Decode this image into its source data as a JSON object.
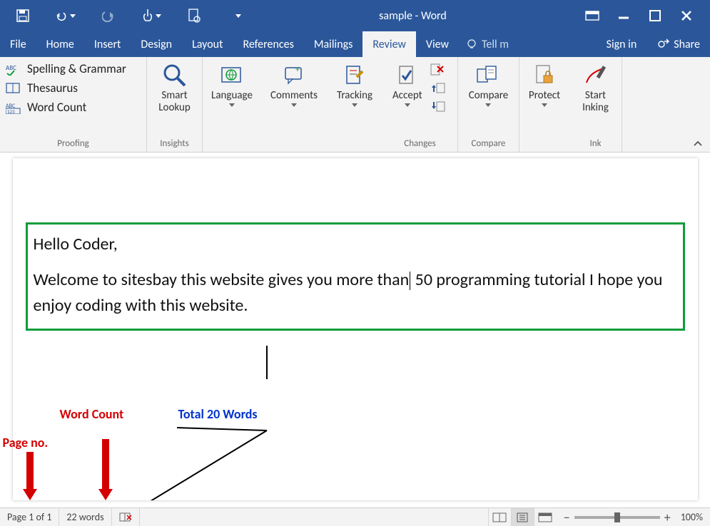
{
  "titlebar": {
    "title": "sample - Word"
  },
  "tabs": {
    "file": "File",
    "home": "Home",
    "insert": "Insert",
    "design": "Design",
    "layout": "Layout",
    "references": "References",
    "mailings": "Mailings",
    "review": "Review",
    "view": "View",
    "tellme": "Tell m",
    "signin": "Sign in",
    "share": "Share"
  },
  "ribbon": {
    "proofing": {
      "spelling": "Spelling & Grammar",
      "thesaurus": "Thesaurus",
      "wordcount": "Word Count",
      "label": "Proofing"
    },
    "insights": {
      "btn": "Smart\nLookup",
      "label": "Insights"
    },
    "language": {
      "btn": "Language"
    },
    "comments": {
      "btn": "Comments"
    },
    "tracking": {
      "btn": "Tracking"
    },
    "accept": {
      "btn": "Accept"
    },
    "changes": {
      "label": "Changes"
    },
    "compare": {
      "btn": "Compare",
      "label": "Compare"
    },
    "protect": {
      "btn": "Protect"
    },
    "ink": {
      "btn": "Start\nInking",
      "label": "Ink"
    }
  },
  "document": {
    "line1": "Hello Coder,",
    "line2a": "Welcome to sitesbay this website gives you more than",
    "line2b": " 50 programming tutorial I hope you enjoy coding with this website."
  },
  "annotations": {
    "wordcount": "Word Count",
    "total": "Total 20 Words",
    "pageno": "Page no."
  },
  "statusbar": {
    "page": "Page 1 of 1",
    "words": "22 words",
    "zoom": "100%"
  }
}
